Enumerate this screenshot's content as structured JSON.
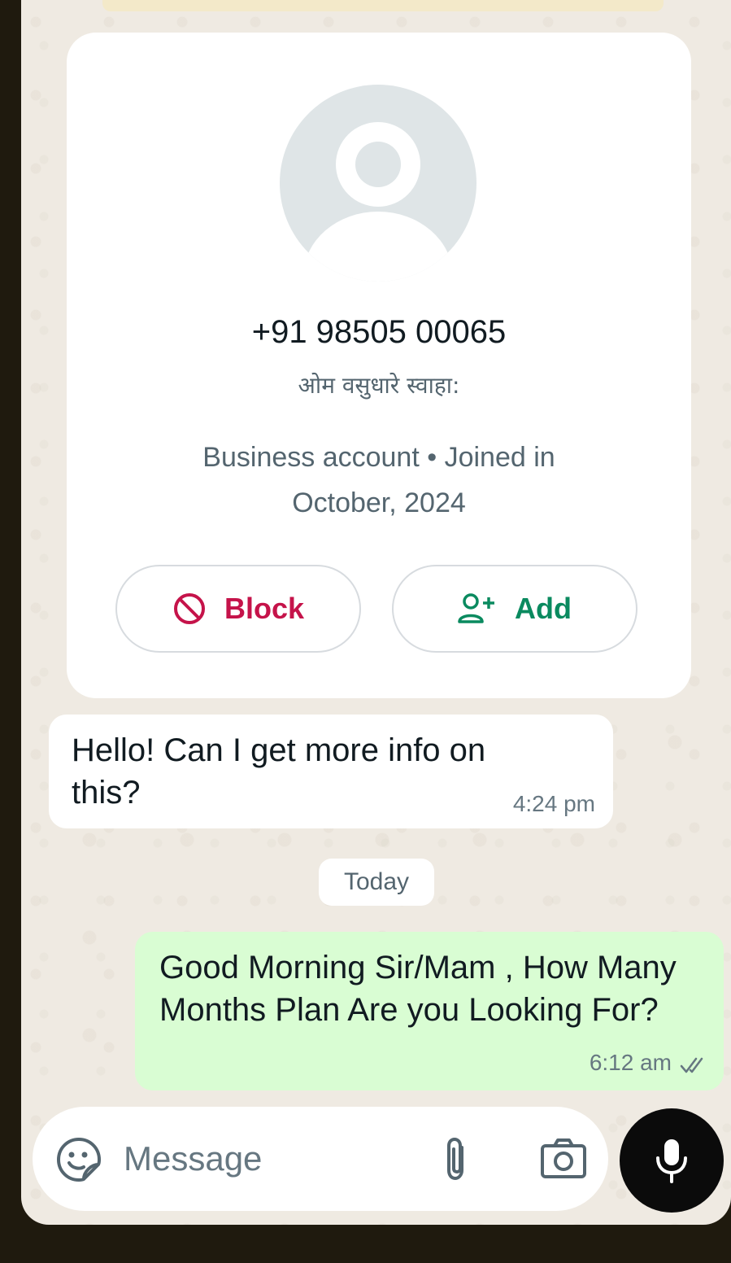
{
  "contact": {
    "phone": "+91 98505 00065",
    "about": "ओम वसुधारे स्वाहा:",
    "meta_line1": "Business account • Joined in",
    "meta_line2": "October, 2024",
    "avatar_icon": "default-person-avatar"
  },
  "actions": {
    "block": {
      "label": "Block",
      "icon": "block-icon",
      "color": "#c5134a"
    },
    "add": {
      "label": "Add",
      "icon": "add-contact-icon",
      "color": "#0a8a5f"
    }
  },
  "messages": [
    {
      "direction": "incoming",
      "text": "Hello! Can I get more info on this?",
      "time": "4:24 pm"
    },
    {
      "direction": "outgoing",
      "text": "Good Morning Sir/Mam , How Many Months Plan Are you Looking For?",
      "time": "6:12 am",
      "status_icon": "double-check-icon"
    }
  ],
  "date_divider": "Today",
  "composer": {
    "placeholder": "Message",
    "emoji_icon": "sticker-icon",
    "attach_icon": "paperclip-icon",
    "camera_icon": "camera-icon",
    "mic_icon": "microphone-icon"
  },
  "colors": {
    "chat_background": "#efeae2",
    "outgoing_bubble": "#d9fdd3",
    "incoming_bubble": "#ffffff"
  }
}
